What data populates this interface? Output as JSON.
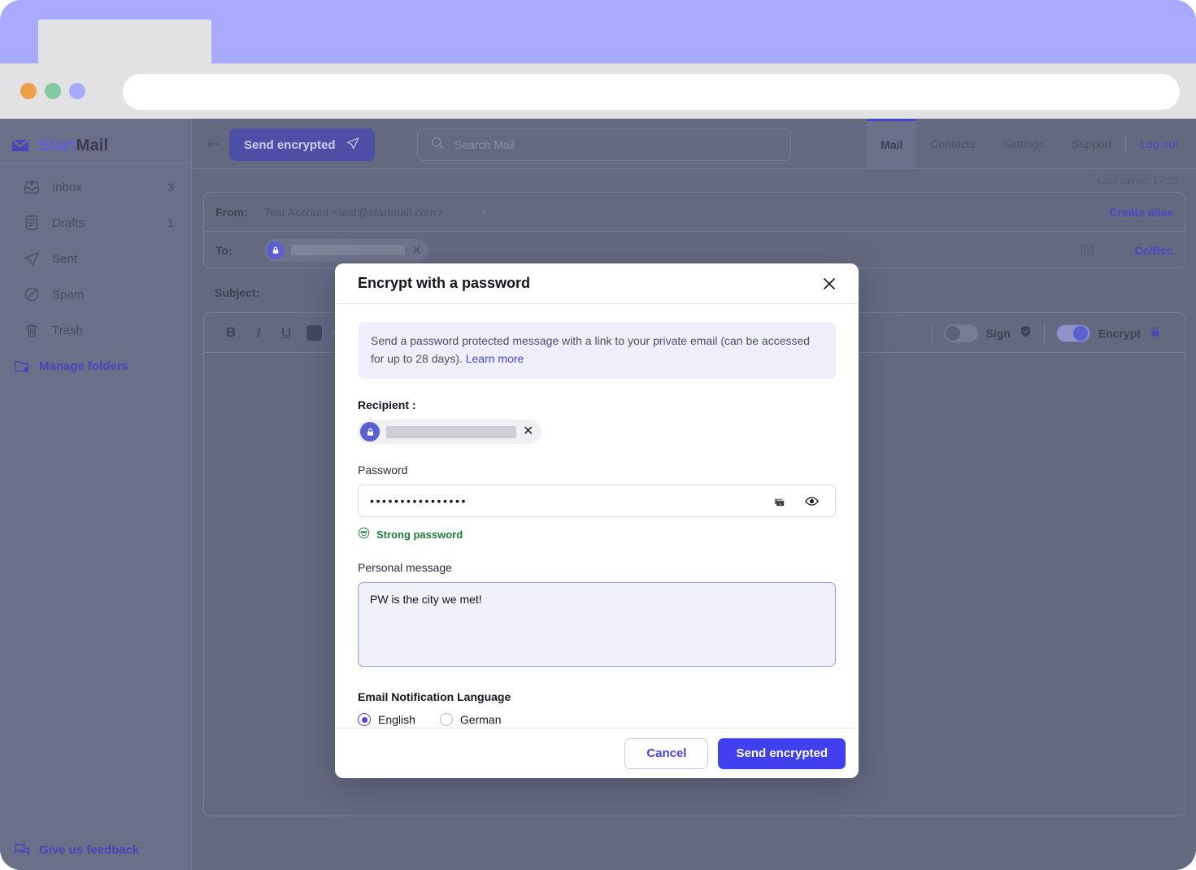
{
  "browser": {
    "traffic_lights": [
      "orange",
      "green",
      "purple"
    ],
    "url_value": ""
  },
  "sidebar": {
    "brand": {
      "start": "Start",
      "mail": "Mail",
      "icon": "envelope-icon"
    },
    "items": [
      {
        "label": "Inbox",
        "count": "3",
        "icon": "inbox-icon"
      },
      {
        "label": "Drafts",
        "count": "1",
        "icon": "document-icon"
      },
      {
        "label": "Sent",
        "count": "",
        "icon": "paper-plane-icon"
      },
      {
        "label": "Spam",
        "count": "",
        "icon": "no-entry-icon"
      },
      {
        "label": "Trash",
        "count": "",
        "icon": "trash-icon"
      }
    ],
    "manage_folders": {
      "label": "Manage folders",
      "icon": "folder-gear-icon"
    },
    "feedback": {
      "label": "Give us feedback",
      "icon": "chat-bubble-icon"
    }
  },
  "topbar": {
    "back_icon": "arrow-left-icon",
    "send_encrypted_label": "Send encrypted",
    "send_icon": "paper-plane-icon",
    "search_placeholder": "Search Mail",
    "search_icon": "search-icon",
    "nav": [
      {
        "label": "Mail",
        "active": true
      },
      {
        "label": "Contacts",
        "active": false
      },
      {
        "label": "Settings",
        "active": false
      },
      {
        "label": "Support",
        "active": false
      }
    ],
    "logout_label": "Log out",
    "last_saved": "Last saved: 17:28"
  },
  "compose": {
    "from_label": "From:",
    "from_value": "Test Account <test@startmail.com>",
    "create_alias_label": "Create alias",
    "to_label": "To:",
    "to_recipient_redacted": true,
    "address_book_icon": "address-book-icon",
    "ccbcc_label": "Cc/Bcc",
    "subject_label": "Subject:",
    "subject_value": "",
    "toolbar": {
      "bold": "B",
      "italic": "I",
      "underline": "U",
      "color_swatch": "#434861",
      "sign_label": "Sign",
      "sign_on": false,
      "sign_icon": "shield-check-icon",
      "encrypt_label": "Encrypt",
      "encrypt_on": true,
      "encrypt_icon": "lock-icon"
    },
    "body_value": ""
  },
  "modal": {
    "title": "Encrypt with a password",
    "close_icon": "close-icon",
    "info_text": "Send a password protected message with a link to your private email (can be accessed for up to 28 days). ",
    "info_link": "Learn more",
    "recipient_label": "Recipient :",
    "recipient_redacted": true,
    "recipient_lock_icon": "lock-icon",
    "recipient_remove_icon": "close-icon",
    "password_label": "Password",
    "password_value": "••••••••••••••••",
    "password_generate_icon": "generate-password-icon",
    "password_reveal_icon": "eye-icon",
    "strength_label": "Strong password",
    "strength_icon": "sunglasses-face-icon",
    "strength_color": "#1d7a3c",
    "personal_message_label": "Personal message",
    "personal_message_value": "PW is the city we met!",
    "language_label": "Email Notification Language",
    "language_options": [
      {
        "label": "English",
        "selected": true
      },
      {
        "label": "German",
        "selected": false
      }
    ],
    "cancel_label": "Cancel",
    "send_label": "Send encrypted",
    "accent_color": "#4040ee"
  }
}
